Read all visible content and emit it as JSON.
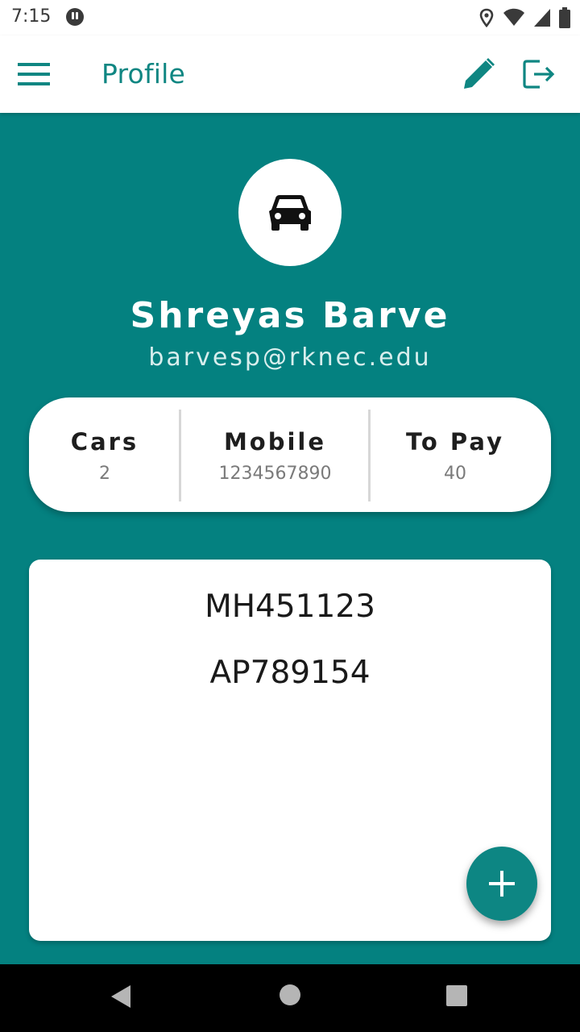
{
  "status_bar": {
    "time": "7:15",
    "icons": [
      "app-notification-icon",
      "location-icon",
      "wifi-icon",
      "signal-icon",
      "battery-icon"
    ]
  },
  "app_bar": {
    "title": "Profile",
    "icons": [
      "menu-icon",
      "edit-icon",
      "logout-icon"
    ]
  },
  "profile": {
    "avatar_icon": "car-icon",
    "name": "Shreyas Barve",
    "email": "barvesp@rknec.edu"
  },
  "stats": [
    {
      "label": "Cars",
      "value": "2"
    },
    {
      "label": "Mobile",
      "value": "1234567890"
    },
    {
      "label": "To Pay",
      "value": "40"
    }
  ],
  "cars": [
    "MH451123",
    "AP789154"
  ],
  "fab": {
    "icon": "add-icon"
  },
  "nav_bar": {
    "icons": [
      "back-icon",
      "home-icon",
      "recents-icon"
    ]
  },
  "colors": {
    "primary": "#048180",
    "accent": "#0f8682",
    "surface": "#ffffff"
  }
}
